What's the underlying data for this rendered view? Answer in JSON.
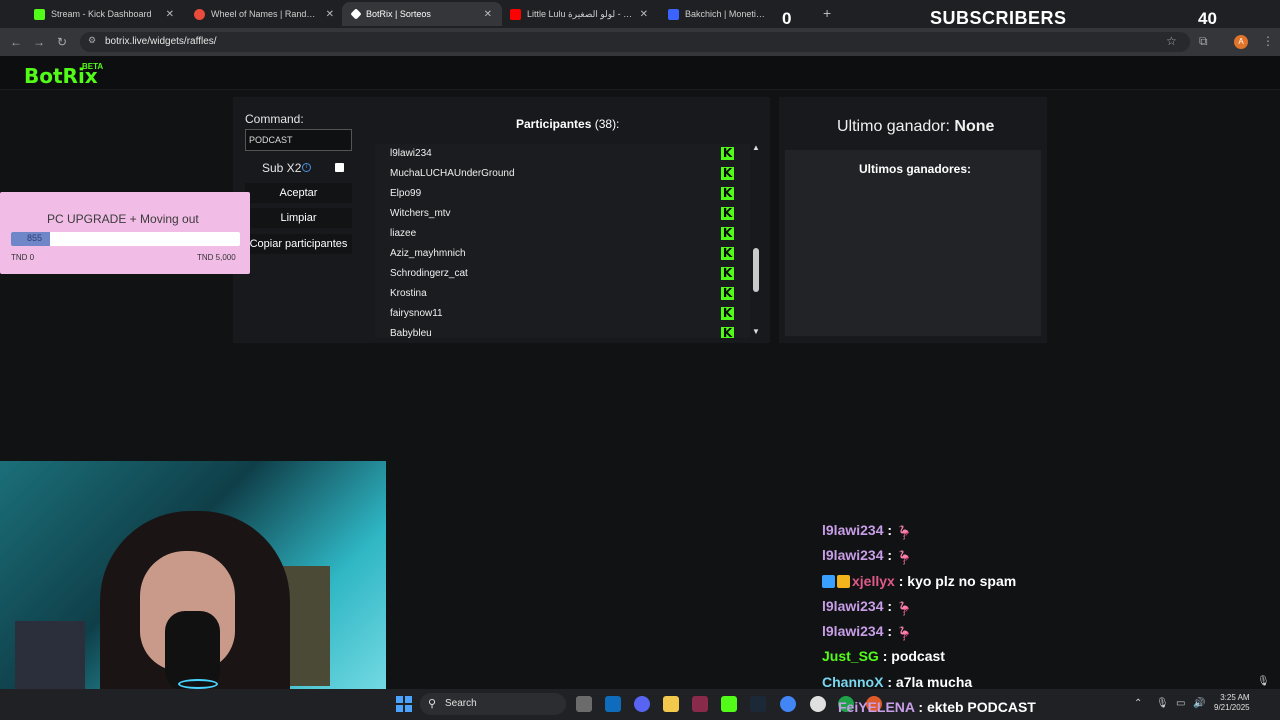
{
  "browser": {
    "tabs": [
      {
        "title": "Stream - Kick Dashboard",
        "color": "#53fc18"
      },
      {
        "title": "Wheel of Names | Random name picker",
        "color": "#e94b3c"
      },
      {
        "title": "BotRix | Sorteos",
        "color": "#ffffff"
      },
      {
        "title": "Little Lulu لولو الصغيرة - YouTube",
        "color": "#ff0000"
      },
      {
        "title": "Bakchich | Monetization for creators",
        "color": "#3a63ff"
      }
    ],
    "url": "botrix.live/widgets/raffles/",
    "avatar_letter": "A"
  },
  "overlay": {
    "left_count": "0",
    "subscribers_label": "SUBSCRIBERS",
    "right_count": "40"
  },
  "app": {
    "logo": "BotRix",
    "beta": "BETA",
    "command_label": "Command:",
    "command_value": "PODCAST",
    "sub_x2_label": "Sub X2",
    "accept_label": "Aceptar",
    "clear_label": "Limpiar",
    "copy_label": "Copiar participantes",
    "participants_label": "Participantes",
    "participants_count": "(38):",
    "participants": [
      "l9lawi234",
      "MuchaLUCHAUnderGround",
      "Elpo99",
      "Witchers_mtv",
      "liazee",
      "Aziz_mayhmnich",
      "Schrodingerz_cat",
      "Krostina",
      "fairysnow11",
      "Babybleu"
    ],
    "last_winner_label": "Ultimo ganador:",
    "last_winner_value": "None",
    "last_winners_title": "Ultimos ganadores:"
  },
  "goal": {
    "title": "PC UPGRADE + Moving out",
    "value": "855",
    "min_label": "TND 0",
    "max_label": "TND 5,000",
    "fraction": 0.171
  },
  "chat": [
    {
      "user": "l9lawi234",
      "message": "",
      "emote": true,
      "user_color": "#c89ee8"
    },
    {
      "user": "l9lawi234",
      "message": "",
      "emote": true,
      "user_color": "#c89ee8"
    },
    {
      "user": "xjellyx",
      "message": "kyo plz no spam",
      "emote": false,
      "user_color": "#e05a8a",
      "badges": true
    },
    {
      "user": "l9lawi234",
      "message": "",
      "emote": true,
      "user_color": "#c89ee8"
    },
    {
      "user": "l9lawi234",
      "message": "",
      "emote": true,
      "user_color": "#c89ee8"
    },
    {
      "user": "Just_SG",
      "message": "podcast",
      "emote": false,
      "user_color": "#53fc18"
    },
    {
      "user": "ChannoX",
      "message": "a7la mucha",
      "emote": false,
      "user_color": "#7ad7f0"
    },
    {
      "user": "FeiYELENA",
      "message": "ekteb PODCAST",
      "emote": false,
      "user_color": "#c89ee8"
    }
  ],
  "taskbar": {
    "search_label": "Search",
    "time": "3:25 AM",
    "date": "9/21/2025"
  }
}
